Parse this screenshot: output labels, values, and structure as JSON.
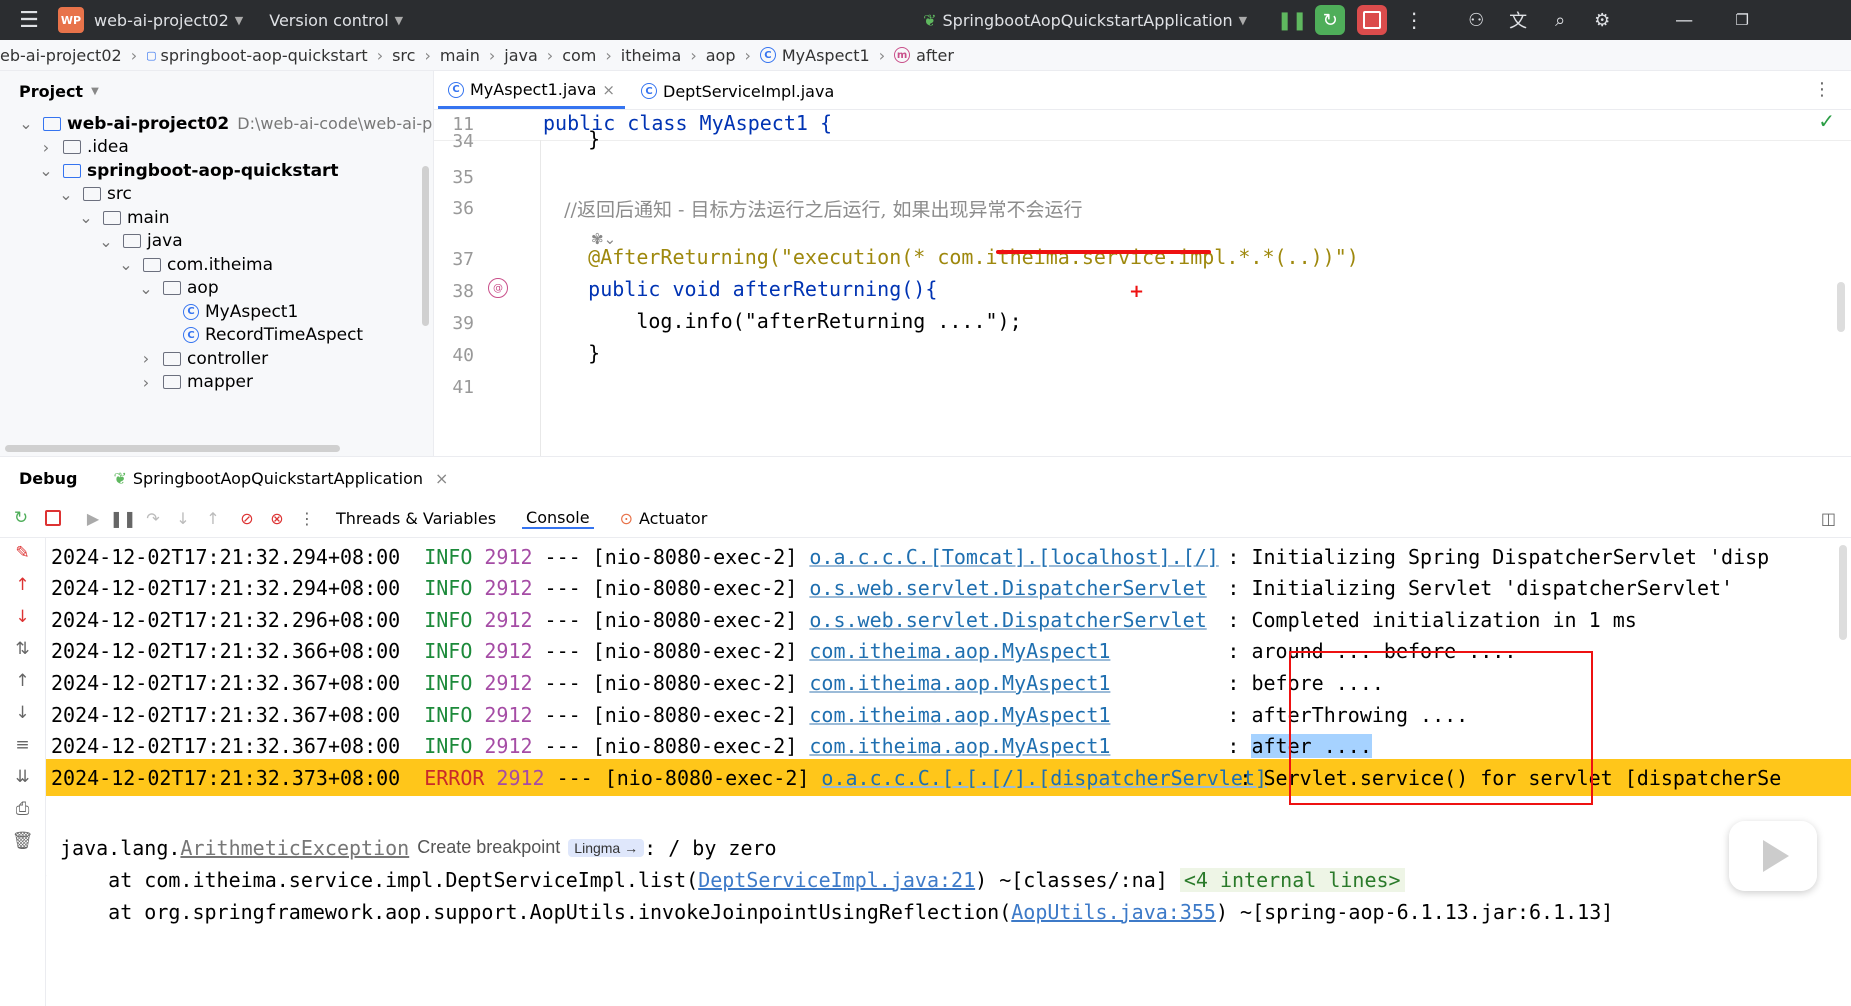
{
  "titlebar": {
    "logo": "WP",
    "project_name": "web-ai-project02",
    "version_control": "Version control",
    "run_config": "SpringbootAopQuickstartApplication"
  },
  "breadcrumb": [
    "eb-ai-project02",
    "springboot-aop-quickstart",
    "src",
    "main",
    "java",
    "com",
    "itheima",
    "aop",
    "MyAspect1",
    "after"
  ],
  "project": {
    "header": "Project",
    "tree": [
      {
        "label": "web-ai-project02",
        "extra": "D:\\web-ai-code\\web-ai-proj",
        "bold": true,
        "level": 0,
        "open": true,
        "kind": "module"
      },
      {
        "label": ".idea",
        "level": 1,
        "open": false,
        "kind": "folder"
      },
      {
        "label": "springboot-aop-quickstart",
        "bold": true,
        "level": 1,
        "open": true,
        "kind": "module"
      },
      {
        "label": "src",
        "level": 2,
        "open": true,
        "kind": "folder"
      },
      {
        "label": "main",
        "level": 3,
        "open": true,
        "kind": "folder"
      },
      {
        "label": "java",
        "level": 4,
        "open": true,
        "kind": "folder"
      },
      {
        "label": "com.itheima",
        "level": 5,
        "open": true,
        "kind": "package"
      },
      {
        "label": "aop",
        "level": 6,
        "open": true,
        "kind": "package"
      },
      {
        "label": "MyAspect1",
        "level": 7,
        "kind": "class"
      },
      {
        "label": "RecordTimeAspect",
        "level": 7,
        "kind": "class"
      },
      {
        "label": "controller",
        "level": 6,
        "open": false,
        "kind": "package"
      },
      {
        "label": "mapper",
        "level": 6,
        "open": false,
        "kind": "package"
      }
    ]
  },
  "editor": {
    "tabs": [
      {
        "label": "MyAspect1.java",
        "active": true,
        "close": "×"
      },
      {
        "label": "DeptServiceImpl.java",
        "active": false
      }
    ],
    "lines": [
      {
        "num": "11",
        "text": "public class MyAspect1 {"
      },
      {
        "num": "34",
        "text": "    }"
      },
      {
        "num": "35",
        "text": ""
      },
      {
        "num": "36",
        "text": "    //返回后通知 - 目标方法运行之后运行, 如果出现异常不会运行"
      },
      {
        "num": "37",
        "text": "    @AfterReturning(\"execution(* com.itheima.service.impl.*.*(..))\")"
      },
      {
        "num": "38",
        "text": "    public void afterReturning(){"
      },
      {
        "num": "39",
        "text": "        log.info(\"afterReturning ....\");"
      },
      {
        "num": "40",
        "text": "    }"
      },
      {
        "num": "41",
        "text": ""
      }
    ]
  },
  "debug": {
    "title": "Debug",
    "session": "SpringbootAopQuickstartApplication",
    "tabs": [
      "Threads & Variables",
      "Console",
      "Actuator"
    ],
    "logs": [
      {
        "ts": "2024-12-02T17:21:32.294+08:00",
        "level": "INFO",
        "pid": "2912",
        "sep": "---",
        "thread": "[nio-8080-exec-2]",
        "logger": "o.a.c.c.C.[Tomcat].[localhost].[/]",
        "msg": ": Initializing Spring DispatcherServlet 'disp"
      },
      {
        "ts": "2024-12-02T17:21:32.294+08:00",
        "level": "INFO",
        "pid": "2912",
        "sep": "---",
        "thread": "[nio-8080-exec-2]",
        "logger": "o.s.web.servlet.DispatcherServlet",
        "msg": ": Initializing Servlet 'dispatcherServlet'"
      },
      {
        "ts": "2024-12-02T17:21:32.296+08:00",
        "level": "INFO",
        "pid": "2912",
        "sep": "---",
        "thread": "[nio-8080-exec-2]",
        "logger": "o.s.web.servlet.DispatcherServlet",
        "msg": ": Completed initialization in 1 ms"
      },
      {
        "ts": "2024-12-02T17:21:32.366+08:00",
        "level": "INFO",
        "pid": "2912",
        "sep": "---",
        "thread": "[nio-8080-exec-2]",
        "logger": "com.itheima.aop.MyAspect1",
        "msg": ": around ... before ...."
      },
      {
        "ts": "2024-12-02T17:21:32.367+08:00",
        "level": "INFO",
        "pid": "2912",
        "sep": "---",
        "thread": "[nio-8080-exec-2]",
        "logger": "com.itheima.aop.MyAspect1",
        "msg": ": before ...."
      },
      {
        "ts": "2024-12-02T17:21:32.367+08:00",
        "level": "INFO",
        "pid": "2912",
        "sep": "---",
        "thread": "[nio-8080-exec-2]",
        "logger": "com.itheima.aop.MyAspect1",
        "msg": ": afterThrowing ...."
      },
      {
        "ts": "2024-12-02T17:21:32.367+08:00",
        "level": "INFO",
        "pid": "2912",
        "sep": "---",
        "thread": "[nio-8080-exec-2]",
        "logger": "com.itheima.aop.MyAspect1",
        "msg_prefix": ": ",
        "msg_hl": "after ...."
      },
      {
        "ts": "2024-12-02T17:21:32.373+08:00",
        "level": "ERROR",
        "pid": "2912",
        "sep": "---",
        "thread": "[nio-8080-exec-2]",
        "logger": "o.a.c.c.C.[.[.[/].[dispatcherServlet]",
        "msg": ": Servlet.service() for servlet [dispatcherSe"
      }
    ],
    "exception": {
      "prefix": "java.lang.",
      "name": "ArithmeticException",
      "create_breakpoint": "Create breakpoint",
      "lingma": "Lingma →",
      "msg": ": / by zero"
    },
    "stack": [
      {
        "prefix": "    at com.itheima.service.impl.DeptServiceImpl.list(",
        "link": "DeptServiceImpl.java:21",
        "suffix": ") ~[classes/:na] ",
        "internal": "<4 internal lines>"
      },
      {
        "prefix": "    at org.springframework.aop.support.AopUtils.invokeJoinpointUsingReflection(",
        "link": "AopUtils.java:355",
        "suffix": ") ~[spring-aop-6.1.13.jar:6.1.13]"
      }
    ]
  }
}
